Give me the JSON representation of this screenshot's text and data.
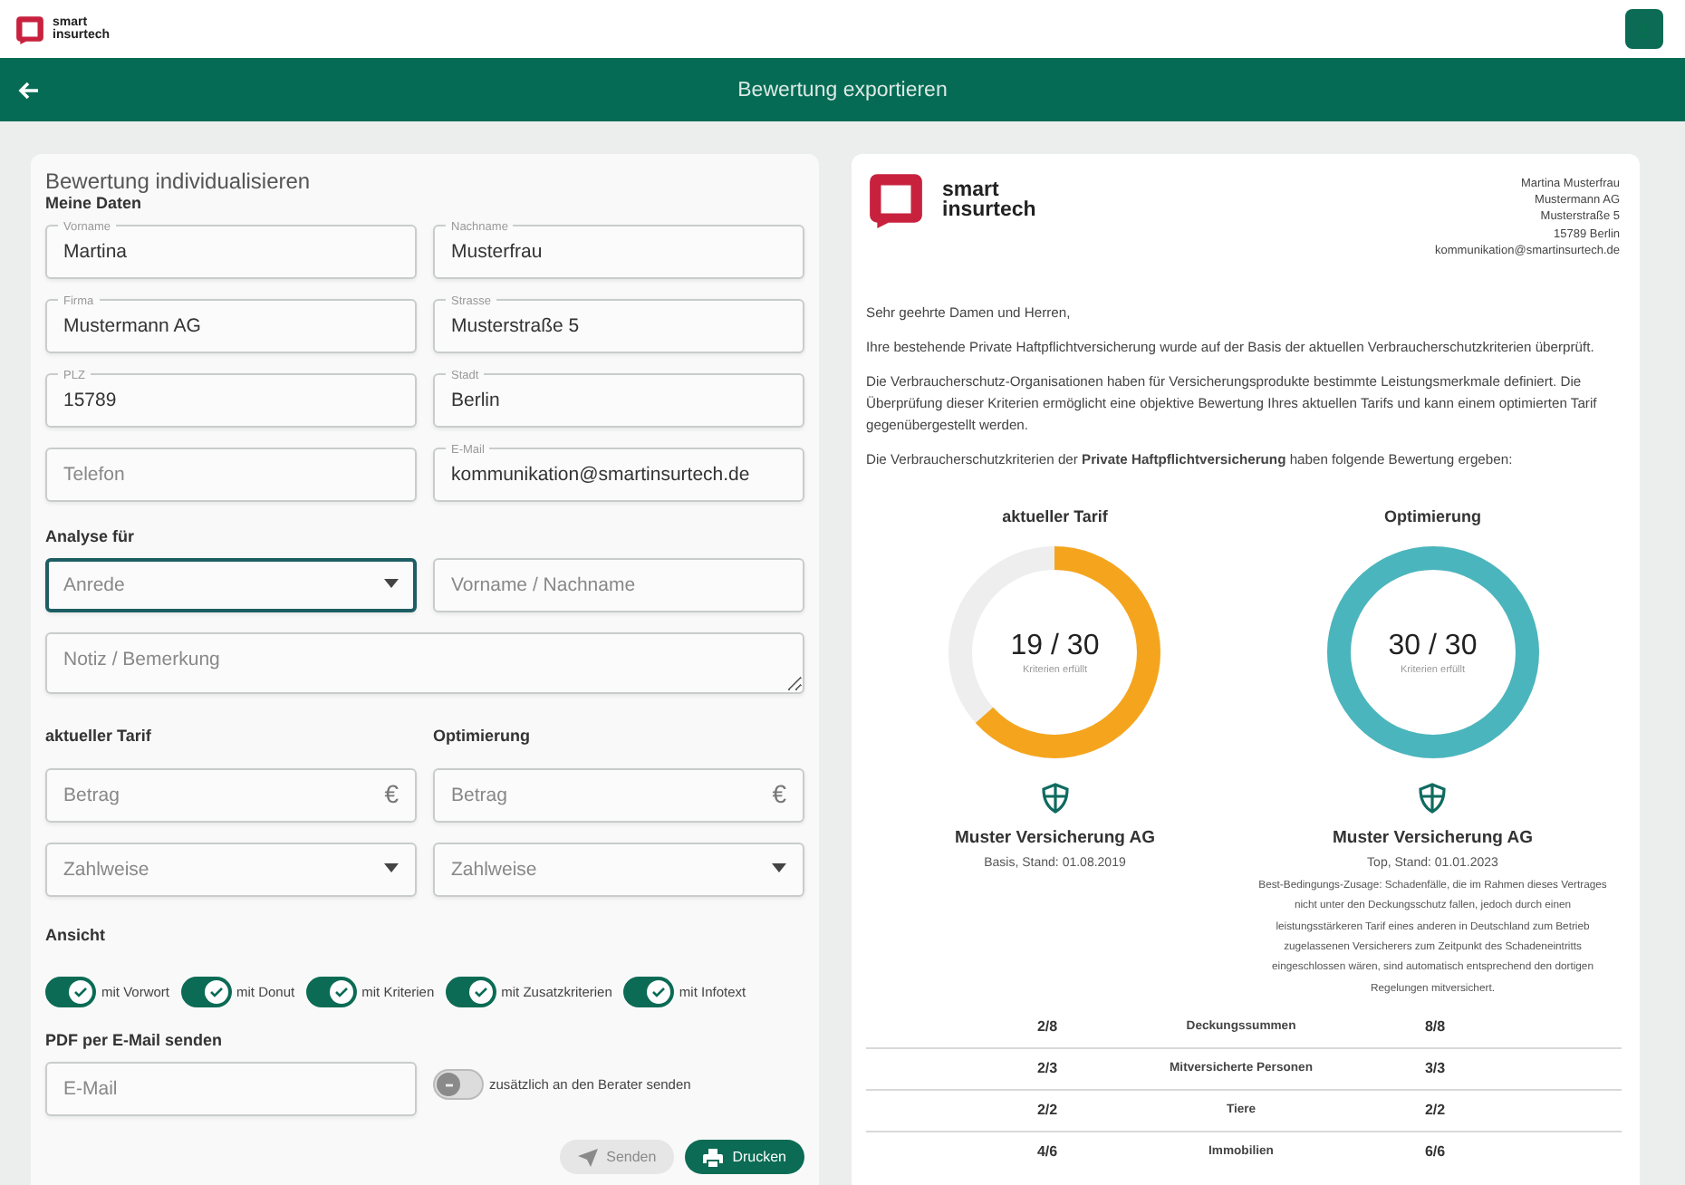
{
  "top_bar": {
    "logo_line1": "smart",
    "logo_line2": "insurtech"
  },
  "title_bar": {
    "title": "Bewertung exportieren"
  },
  "form": {
    "title": "Bewertung individualisieren",
    "my_data": {
      "heading": "Meine Daten",
      "rows": [
        {
          "fields": [
            {
              "kind": "text",
              "label": "Vorname",
              "value": "Martina"
            },
            {
              "kind": "text",
              "label": "Nachname",
              "value": "Musterfrau"
            }
          ]
        },
        {
          "fields": [
            {
              "kind": "text",
              "label": "Firma",
              "value": "Mustermann AG"
            },
            {
              "kind": "text",
              "label": "Strasse",
              "value": "Musterstraße 5"
            }
          ]
        },
        {
          "fields": [
            {
              "kind": "text",
              "label": "PLZ",
              "value": "15789"
            },
            {
              "kind": "text",
              "label": "Stadt",
              "value": "Berlin"
            }
          ]
        },
        {
          "fields": [
            {
              "kind": "text",
              "placeholder": "Telefon"
            },
            {
              "kind": "text",
              "label": "E-Mail",
              "value": "kommunikation@smartinsurtech.de"
            }
          ]
        }
      ]
    },
    "analysis": {
      "heading": "Analyse für",
      "fields": [
        {
          "kind": "select",
          "placeholder": "Anrede",
          "focused": true
        },
        {
          "kind": "text",
          "placeholder": "Vorname / Nachname",
          "focused": false
        },
        {
          "kind": "textarea",
          "placeholder": "Notiz / Bemerkung",
          "focused": false
        }
      ]
    },
    "tariffs": [
      {
        "heading": "aktueller Tarif",
        "fields": [
          {
            "kind": "amount",
            "placeholder": "Betrag",
            "unit": "€"
          },
          {
            "kind": "select",
            "placeholder": "Zahlweise"
          }
        ]
      },
      {
        "heading": "Optimierung",
        "fields": [
          {
            "kind": "amount",
            "placeholder": "Betrag",
            "unit": "€"
          },
          {
            "kind": "select",
            "placeholder": "Zahlweise"
          }
        ]
      }
    ],
    "view": {
      "heading": "Ansicht",
      "toggles": [
        {
          "label": "mit Vorwort",
          "on": true
        },
        {
          "label": "mit Donut",
          "on": true
        },
        {
          "label": "mit Kriterien",
          "on": true
        },
        {
          "label": "mit Zusatzkriterien",
          "on": true
        },
        {
          "label": "mit Infotext",
          "on": true
        }
      ]
    },
    "pdf": {
      "heading": "PDF per E-Mail senden",
      "email": {
        "kind": "text",
        "placeholder": "E-Mail"
      },
      "advisor_toggle": {
        "label": "zusätzlich an den Berater senden",
        "on": false
      }
    },
    "buttons": [
      {
        "kind": "send",
        "label": "Senden",
        "disabled": true
      },
      {
        "kind": "print",
        "label": "Drucken",
        "disabled": false
      }
    ]
  },
  "letter": {
    "logo_line1": "smart",
    "logo_line2": "insurtech",
    "recipient": [
      "Martina Musterfrau",
      "Mustermann AG",
      "Musterstraße 5",
      "15789 Berlin",
      "kommunikation@smartinsurtech.de"
    ],
    "paragraphs": [
      "Sehr geehrte Damen und Herren,",
      "Ihre bestehende Private Haftpflichtversicherung wurde auf der Basis der aktuellen Verbraucherschutzkriterien überprüft.",
      "Die Verbraucherschutz-Organisationen haben für Versicherungsprodukte bestimmte Leistungsmerkmale definiert. Die Überprüfung dieser Kriterien ermöglicht eine objektive Bewertung Ihres aktuellen Tarifs und kann einem optimierten Tarif gegenübergestellt werden.",
      "Die Verbraucherschutzkriterien der **Private Haftpflichtversicherung** haben folgende Bewertung ergeben:"
    ],
    "comparison": [
      {
        "heading": "aktueller Tarif",
        "score": "19 / 30",
        "caption": "Kriterien erfüllt",
        "level": 0.633,
        "color": "#f5a51d",
        "insurer": "Muster Versicherung AG",
        "stand": "Basis, Stand: 01.08.2019"
      },
      {
        "heading": "Optimierung",
        "score": "30 / 30",
        "caption": "Kriterien erfüllt",
        "level": 1,
        "color": "#4bb5bd",
        "insurer": "Muster Versicherung AG",
        "stand": "Top, Stand: 01.01.2023",
        "note": "Best-Bedingungs-Zusage: Schadenfälle, die im Rahmen dieses Vertrages nicht unter den Deckungsschutz fallen, jedoch durch einen leistungsstärkeren Tarif eines anderen in Deutschland zum Betrieb zugelassenen Versicherers zum Zeitpunkt des Schadeneintritts eingeschlossen wären, sind automatisch entsprechend den dortigen Regelungen mitversichert."
      }
    ],
    "criteria": [
      {
        "current": "2/8",
        "criterion": "Deckungssummen",
        "optimized": "8/8"
      },
      {
        "current": "2/3",
        "criterion": "Mitversicherte Personen",
        "optimized": "3/3"
      },
      {
        "current": "2/2",
        "criterion": "Tiere",
        "optimized": "2/2"
      },
      {
        "current": "4/6",
        "criterion": "Immobilien",
        "optimized": "6/6"
      }
    ]
  }
}
